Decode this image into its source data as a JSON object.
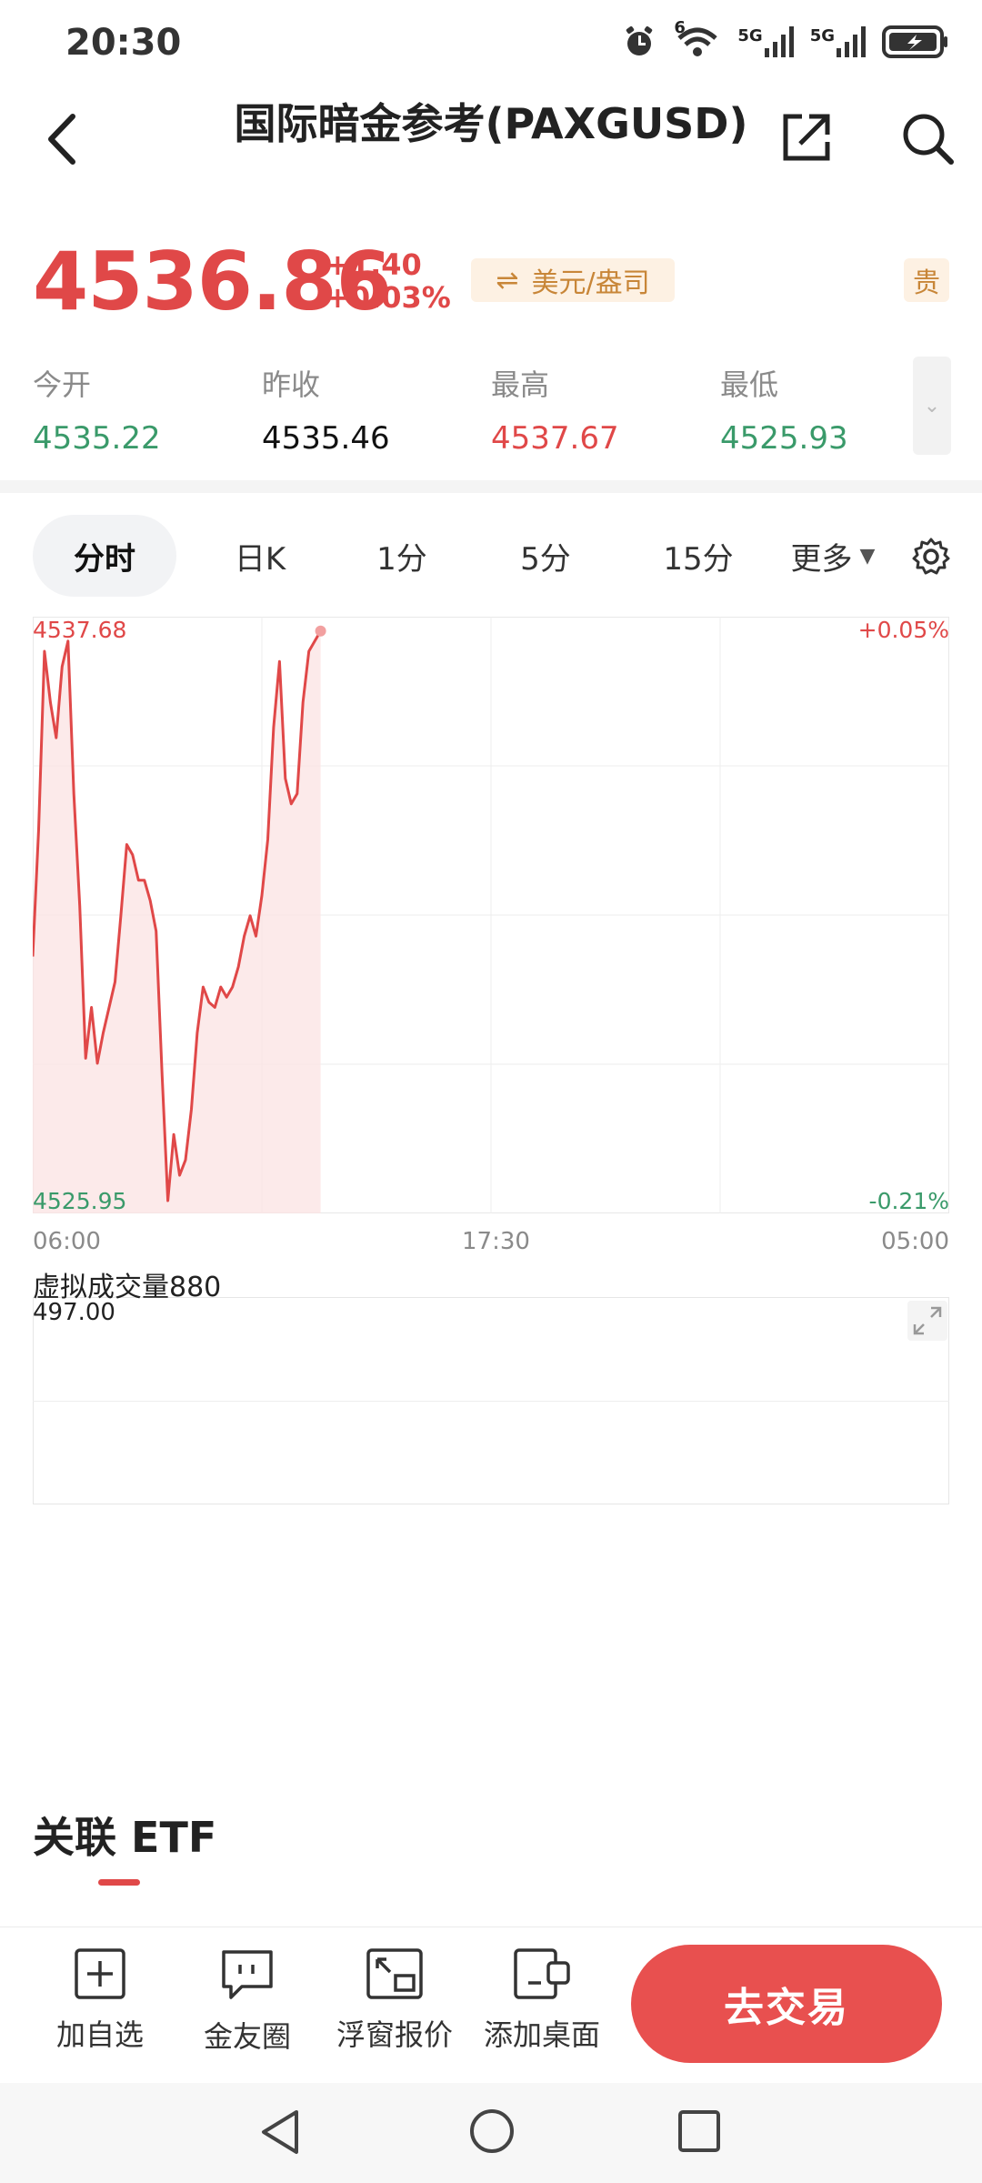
{
  "status": {
    "time": "20:30",
    "net1": "5G",
    "net2": "5G",
    "wifi_badge": "6"
  },
  "header": {
    "title": "国际暗金参考(PAXGUSD)"
  },
  "quote": {
    "price": "4536.86",
    "change": "+1.40",
    "change_pct": "+0.03%",
    "unit": "美元/盎司",
    "tag": "贵"
  },
  "stats": [
    {
      "label": "今开",
      "value": "4535.22",
      "trend": "down"
    },
    {
      "label": "昨收",
      "value": "4535.46",
      "trend": "flat"
    },
    {
      "label": "最高",
      "value": "4537.67",
      "trend": "up"
    },
    {
      "label": "最低",
      "value": "4525.93",
      "trend": "down"
    }
  ],
  "tabs": [
    {
      "label": "分时",
      "active": true
    },
    {
      "label": "日K"
    },
    {
      "label": "1分"
    },
    {
      "label": "5分"
    },
    {
      "label": "15分"
    },
    {
      "label": "更多"
    }
  ],
  "colors": {
    "up": "#e04848",
    "down": "#3a9a6a",
    "accent": "#e8504f"
  },
  "chart_data": {
    "type": "area",
    "ylim": [
      4525.95,
      4537.68
    ],
    "y_top_label": "4537.68",
    "y_bottom_label": "4525.95",
    "pct_top_label": "+0.05%",
    "pct_bottom_label": "-0.21%",
    "x_ticks": [
      "06:00",
      "17:30",
      "05:00"
    ],
    "x": [
      0,
      0.1,
      0.2,
      0.3,
      0.4,
      0.5,
      0.6,
      0.7,
      0.8,
      0.9,
      1.0,
      1.1,
      1.2,
      1.3,
      1.4,
      1.5,
      1.6,
      1.7,
      1.8,
      1.9,
      2.0,
      2.1,
      2.2,
      2.3,
      2.4,
      2.5,
      2.6,
      2.7,
      2.8,
      2.9,
      3.0,
      3.1,
      3.2,
      3.3,
      3.4,
      3.5,
      3.6,
      3.7,
      3.8,
      3.9,
      4.0,
      4.1,
      4.2,
      4.3,
      4.4,
      4.5,
      4.6,
      4.7,
      4.8,
      4.9,
      5.0,
      5.1,
      5.2,
      5.3,
      5.4,
      5.5,
      5.6,
      5.7,
      5.8,
      5.9,
      6.0,
      6.1,
      6.2,
      6.3
    ],
    "values": [
      4531.0,
      4533.5,
      4537.0,
      4536.0,
      4535.3,
      4536.7,
      4537.2,
      4534.2,
      4532.0,
      4529.0,
      4530.0,
      4528.9,
      4529.5,
      4530.0,
      4530.5,
      4531.8,
      4533.2,
      4533.0,
      4532.5,
      4532.5,
      4532.1,
      4531.5,
      4528.7,
      4526.2,
      4527.5,
      4526.7,
      4527.0,
      4528.0,
      4529.5,
      4530.4,
      4530.1,
      4530.0,
      4530.4,
      4530.2,
      4530.4,
      4530.8,
      4531.4,
      4531.8,
      4531.4,
      4532.2,
      4533.3,
      4535.5,
      4536.8,
      4534.5,
      4534.0,
      4534.2,
      4536.0,
      4537.0,
      4537.2,
      4537.4
    ],
    "volume_label": "虚拟成交量880",
    "volume_value": "497.00"
  },
  "etf": {
    "title": "关联 ETF"
  },
  "toolbar": [
    {
      "label": "加自选",
      "icon": "plus-square-icon"
    },
    {
      "label": "金友圈",
      "icon": "chat-bubble-icon"
    },
    {
      "label": "浮窗报价",
      "icon": "float-window-icon"
    },
    {
      "label": "添加桌面",
      "icon": "add-desktop-icon"
    }
  ],
  "trade_button": "去交易"
}
